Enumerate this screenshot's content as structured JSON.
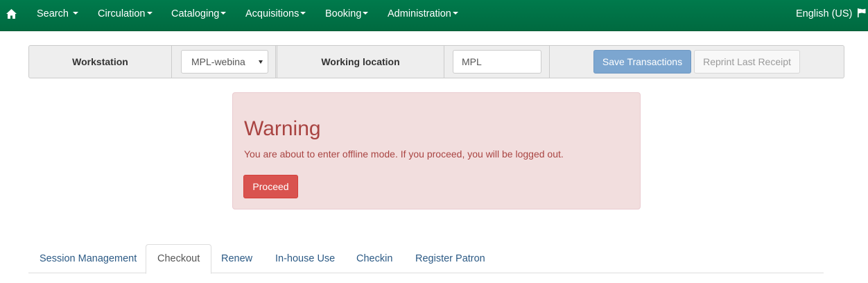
{
  "navbar": {
    "items": [
      {
        "label": "Search"
      },
      {
        "label": "Circulation"
      },
      {
        "label": "Cataloging"
      },
      {
        "label": "Acquisitions"
      },
      {
        "label": "Booking"
      },
      {
        "label": "Administration"
      }
    ],
    "language": "English (US)"
  },
  "toolbar": {
    "workstation_label": "Workstation",
    "workstation_value": "MPL-webina",
    "working_location_label": "Working location",
    "working_location_value": "MPL",
    "save_label": "Save Transactions",
    "reprint_label": "Reprint Last Receipt"
  },
  "alert": {
    "title": "Warning",
    "message": "You are about to enter offline mode. If you proceed, you will be logged out.",
    "proceed_label": "Proceed"
  },
  "tabs": [
    {
      "label": "Session Management",
      "active": false
    },
    {
      "label": "Checkout",
      "active": true
    },
    {
      "label": "Renew",
      "active": false
    },
    {
      "label": "In-house Use",
      "active": false
    },
    {
      "label": "Checkin",
      "active": false
    },
    {
      "label": "Register Patron",
      "active": false
    }
  ],
  "colors": {
    "navbar": "#007a4c",
    "primary": "#7ca6d0",
    "danger": "#d9534f",
    "alert_bg": "#f2dede",
    "alert_text": "#a94442",
    "link": "#2c5a85"
  }
}
